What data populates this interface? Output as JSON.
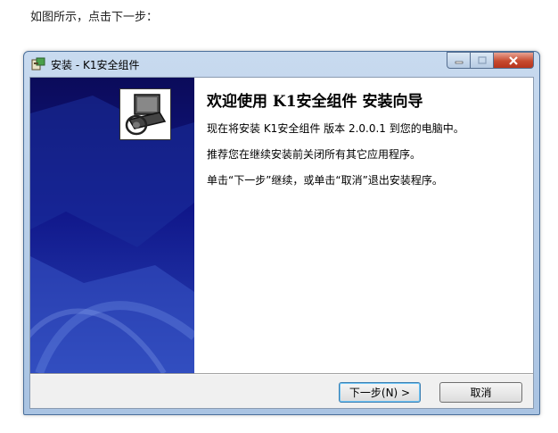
{
  "caption": "如图所示，点击下一步：",
  "window": {
    "title": "安装 - K1安全组件",
    "controls": {
      "minimize": "minimize",
      "maximize": "maximize",
      "close": "close"
    }
  },
  "wizard": {
    "heading": "欢迎使用 K1安全组件 安装向导",
    "line1": "现在将安装 K1安全组件 版本 2.0.0.1 到您的电脑中。",
    "line2": "推荐您在继续安装前关闭所有其它应用程序。",
    "line3": "单击“下一步”继续，或单击“取消”退出安装程序。"
  },
  "buttons": {
    "next": "下一步(N) >",
    "cancel": "取消"
  },
  "colors": {
    "side_panel_top": "#0b0b5a",
    "side_panel_bottom": "#2a44b8",
    "close_button": "#c74a2f"
  }
}
